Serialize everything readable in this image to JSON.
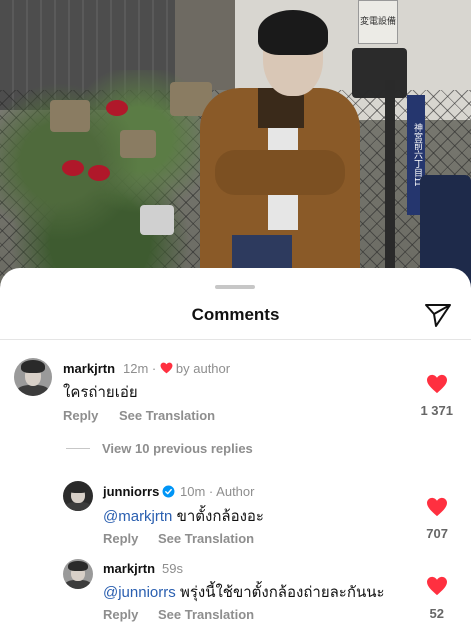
{
  "photo": {
    "sign_text": "変電設備",
    "blue_sign_text": "神宮前六丁目11"
  },
  "sheet": {
    "title": "Comments"
  },
  "comments": [
    {
      "username": "markjrtn",
      "time": "12m",
      "separator": "·",
      "author_badge": "by author",
      "text": "ใครถ่ายเอ่ย",
      "reply": "Reply",
      "see_translation": "See Translation",
      "likes": "1 371"
    }
  ],
  "view_replies": "View 10 previous replies",
  "replies": [
    {
      "username": "junniorrs",
      "time": "10m",
      "separator": "·",
      "author_label": "Author",
      "mention": "@markjrtn",
      "text": "ขาตั้งกล้องอะ",
      "reply": "Reply",
      "see_translation": "See Translation",
      "likes": "707"
    },
    {
      "username": "markjrtn",
      "time": "59s",
      "mention": "@junniorrs",
      "text": "พรุ่งนี้ใช้ขาตั้งกล้องถ่ายละกันนะ",
      "reply": "Reply",
      "see_translation": "See Translation",
      "likes": "52"
    }
  ],
  "colors": {
    "heart": "#ff3040",
    "mention": "#2a5fb0",
    "verified": "#0095f6",
    "muted": "#8e8e8e"
  },
  "icons": [
    "send-icon",
    "heart-icon",
    "verified-icon",
    "avatar"
  ]
}
